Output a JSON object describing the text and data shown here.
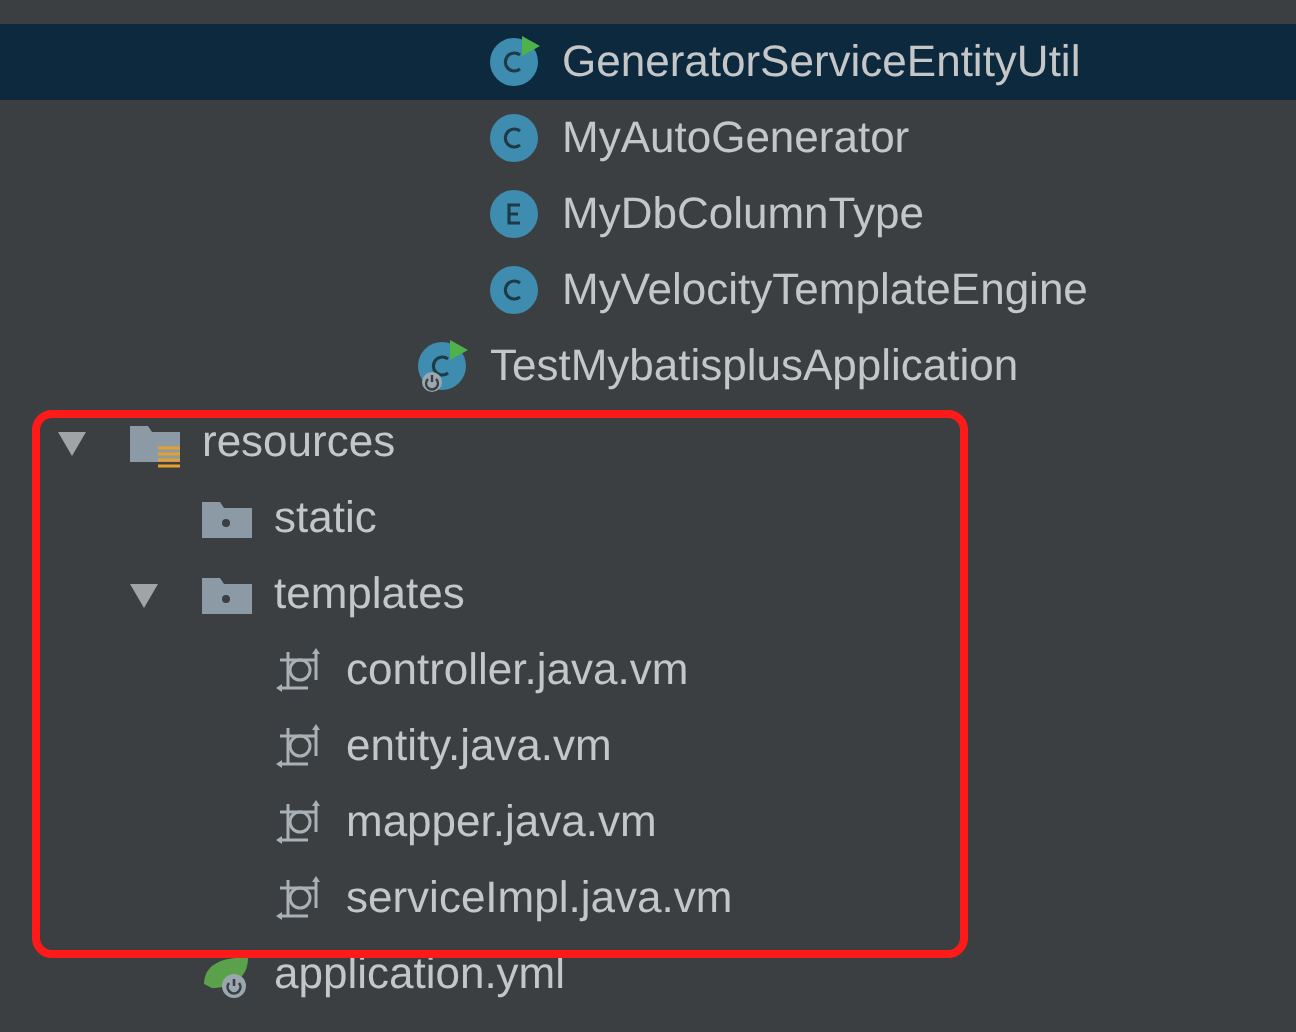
{
  "utils_children": [
    {
      "label": "GeneratorServiceEntityUtil",
      "kind": "runnable-class",
      "selected": true
    },
    {
      "label": "MyAutoGenerator",
      "kind": "class",
      "selected": false
    },
    {
      "label": "MyDbColumnType",
      "kind": "enum",
      "selected": false
    },
    {
      "label": "MyVelocityTemplateEngine",
      "kind": "class",
      "selected": false
    }
  ],
  "java_items": [
    {
      "label": "TestMybatisplusApplication",
      "kind": "spring-app",
      "selected": false
    }
  ],
  "tree": [
    {
      "label": "resources",
      "kind": "resources-folder",
      "selected": false,
      "expanded": true,
      "children": [
        {
          "label": "static",
          "kind": "folder",
          "selected": false
        },
        {
          "label": "templates",
          "kind": "folder",
          "selected": false,
          "expanded": true,
          "children": [
            {
              "label": "controller.java.vm",
              "kind": "template",
              "selected": false
            },
            {
              "label": "entity.java.vm",
              "kind": "template",
              "selected": false
            },
            {
              "label": "mapper.java.vm",
              "kind": "template",
              "selected": false
            },
            {
              "label": "serviceImpl.java.vm",
              "kind": "template",
              "selected": false
            }
          ]
        },
        {
          "label": "application.yml",
          "kind": "spring-yml",
          "selected": false
        }
      ]
    }
  ]
}
